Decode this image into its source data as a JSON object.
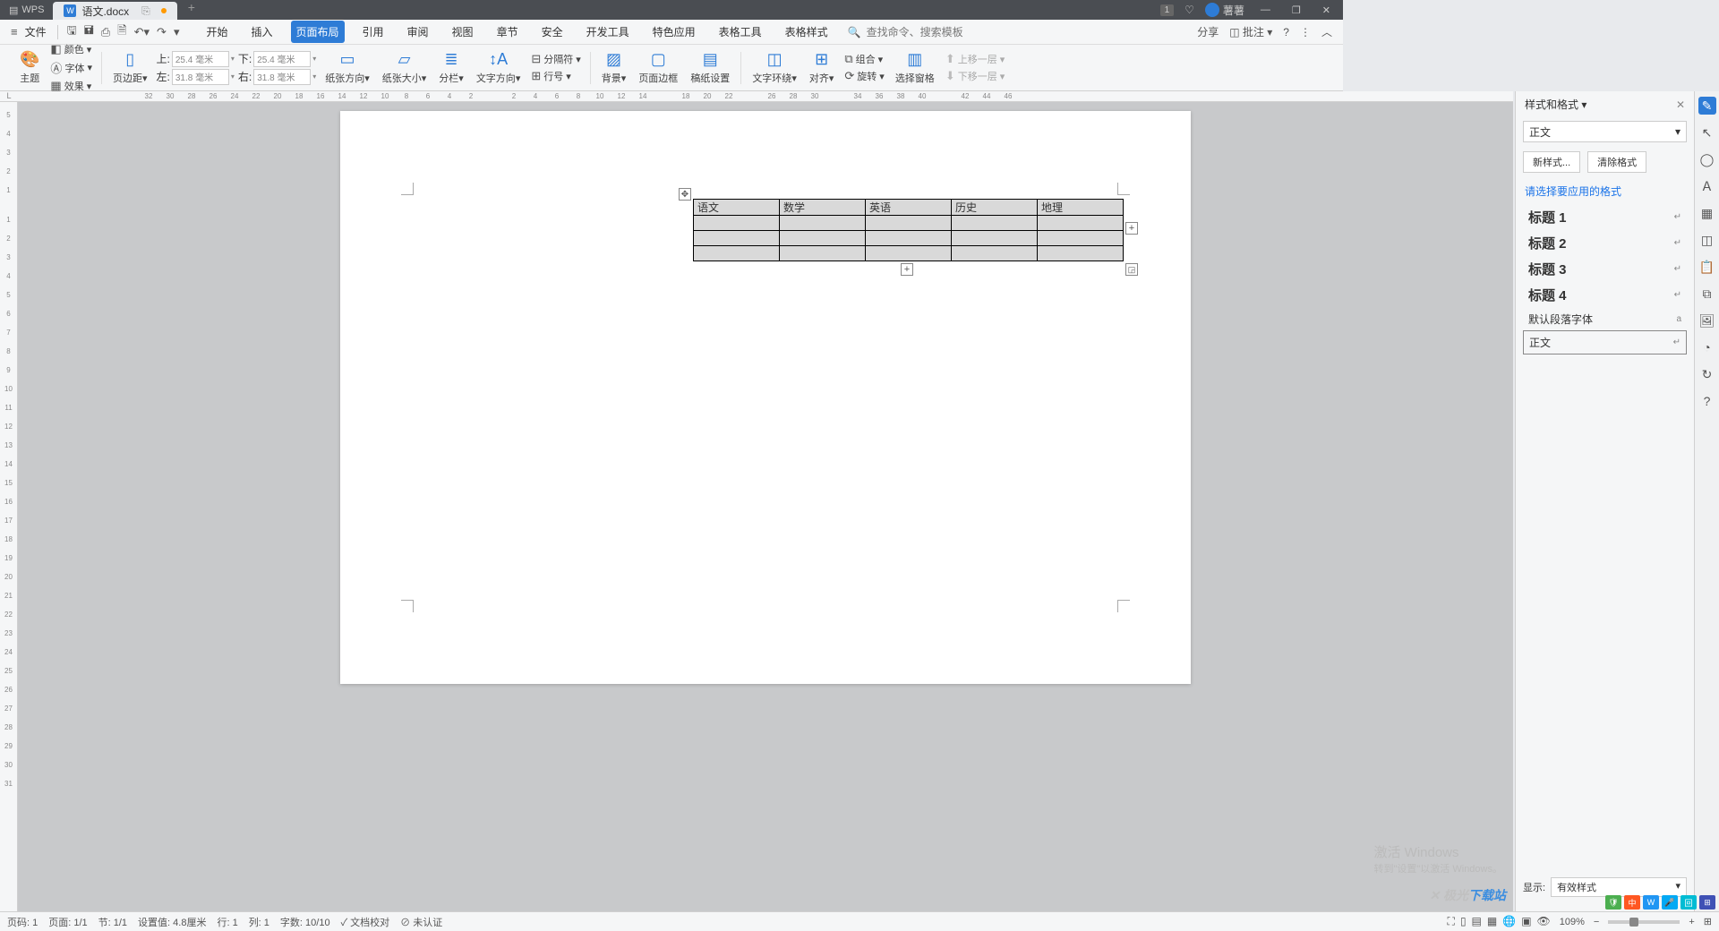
{
  "titlebar": {
    "app": "WPS",
    "doc_name": "语文.docx",
    "notif_badge": "1",
    "user_name": "薯薯"
  },
  "menubar": {
    "file": "文件",
    "tabs": [
      "开始",
      "插入",
      "页面布局",
      "引用",
      "审阅",
      "视图",
      "章节",
      "安全",
      "开发工具",
      "特色应用",
      "表格工具",
      "表格样式"
    ],
    "active_tab_index": 2,
    "search_placeholder": "查找命令、搜索模板",
    "share": "分享",
    "note": "批注"
  },
  "ribbon": {
    "theme": "主题",
    "color": "颜色",
    "font": "字体",
    "effect": "效果",
    "margin": "页边距",
    "orientation": "纸张方向",
    "size": "纸张大小",
    "columns": "分栏",
    "text_dir": "文字方向",
    "breaks": "分隔符",
    "line_no": "行号",
    "bg": "背景",
    "border": "页面边框",
    "manuscript": "稿纸设置",
    "wrap": "文字环绕",
    "align": "对齐",
    "group": "组合",
    "rotate": "旋转",
    "select_pane": "选择窗格",
    "bring_fwd": "上移一层",
    "send_back": "下移一层",
    "margins": {
      "top_label": "上:",
      "top": "25.4 毫米",
      "bottom_label": "下:",
      "bottom": "25.4 毫米",
      "left_label": "左:",
      "left": "31.8 毫米",
      "right_label": "右:",
      "right": "31.8 毫米"
    }
  },
  "table": {
    "headers": [
      "语文",
      "数学",
      "英语",
      "历史",
      "地理"
    ]
  },
  "styles_panel": {
    "title": "样式和格式",
    "current": "正文",
    "new_btn": "新样式...",
    "clear_btn": "清除格式",
    "hint": "请选择要应用的格式",
    "items": [
      {
        "name": "标题 1",
        "small": false
      },
      {
        "name": "标题 2",
        "small": false
      },
      {
        "name": "标题 3",
        "small": false
      },
      {
        "name": "标题 4",
        "small": false
      },
      {
        "name": "默认段落字体",
        "small": true
      },
      {
        "name": "正文",
        "small": true,
        "active": true
      }
    ],
    "show_label": "显示:",
    "show_value": "有效样式"
  },
  "statusbar": {
    "page_no": "页码: 1",
    "page": "页面: 1/1",
    "section": "节: 1/1",
    "pos": "设置值: 4.8厘米",
    "line": "行: 1",
    "col": "列: 1",
    "words": "字数: 10/10",
    "proof": "文档校对",
    "auth": "未认证",
    "zoom": "109%"
  },
  "watermark": {
    "win1": "激活 Windows",
    "win2": "转到\"设置\"以激活 Windows。",
    "site1": "极光",
    "site2": "下载站"
  },
  "ruler_h": [
    "32",
    "30",
    "28",
    "26",
    "24",
    "22",
    "20",
    "18",
    "16",
    "14",
    "12",
    "10",
    "8",
    "6",
    "4",
    "2",
    "",
    "2",
    "4",
    "6",
    "8",
    "10",
    "12",
    "14",
    "",
    "18",
    "20",
    "22",
    "",
    "26",
    "28",
    "30",
    "",
    "34",
    "36",
    "38",
    "40",
    "",
    "42",
    "44",
    "46"
  ],
  "ruler_v": [
    "5",
    "4",
    "3",
    "2",
    "1",
    "",
    "1",
    "2",
    "3",
    "4",
    "5",
    "6",
    "7",
    "8",
    "9",
    "10",
    "11",
    "12",
    "13",
    "14",
    "15",
    "16",
    "17",
    "18",
    "19",
    "20",
    "21",
    "22",
    "23",
    "24",
    "25",
    "26",
    "27",
    "28",
    "29",
    "30",
    "31"
  ]
}
